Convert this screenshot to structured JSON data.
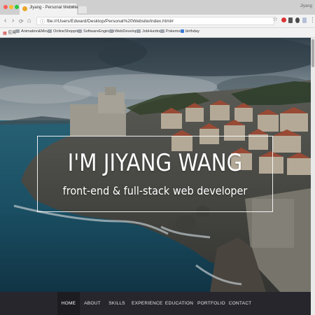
{
  "window": {
    "tab_title": "Jiyang - Personal Website",
    "tab_close": "×",
    "user": "Jiyang"
  },
  "toolbar": {
    "back": "‹",
    "forward": "›",
    "reload": "⟳",
    "home": "⌂",
    "url": "file:///Users/Edward/Desktop/Personal%20Website/index.html#",
    "url_icon": "ⓘ",
    "star": "☆"
  },
  "bookmarks": [
    {
      "label": "应用",
      "icon": "apps-grid-icon"
    },
    {
      "label": "Animation&Movie",
      "icon": "folder-icon"
    },
    {
      "label": "OnlineShopping",
      "icon": "folder-icon"
    },
    {
      "label": "SoftwareEngineer",
      "icon": "folder-icon"
    },
    {
      "label": "WebDevelope",
      "icon": "folder-icon"
    },
    {
      "label": "JobHunting",
      "icon": "folder-icon"
    },
    {
      "label": "Pokemon",
      "icon": "folder-icon"
    },
    {
      "label": "birthday",
      "icon": "bookmark-icon"
    }
  ],
  "hero": {
    "title": "I'M JIYANG WANG",
    "subtitle": "front-end & full-stack web developer"
  },
  "nav": {
    "items": [
      "HOME",
      "ABOUT",
      "SKILLS",
      "EXPERIENCE",
      "EDUCATION",
      "PORTFOLIO",
      "CONTACT"
    ],
    "active": "HOME"
  }
}
